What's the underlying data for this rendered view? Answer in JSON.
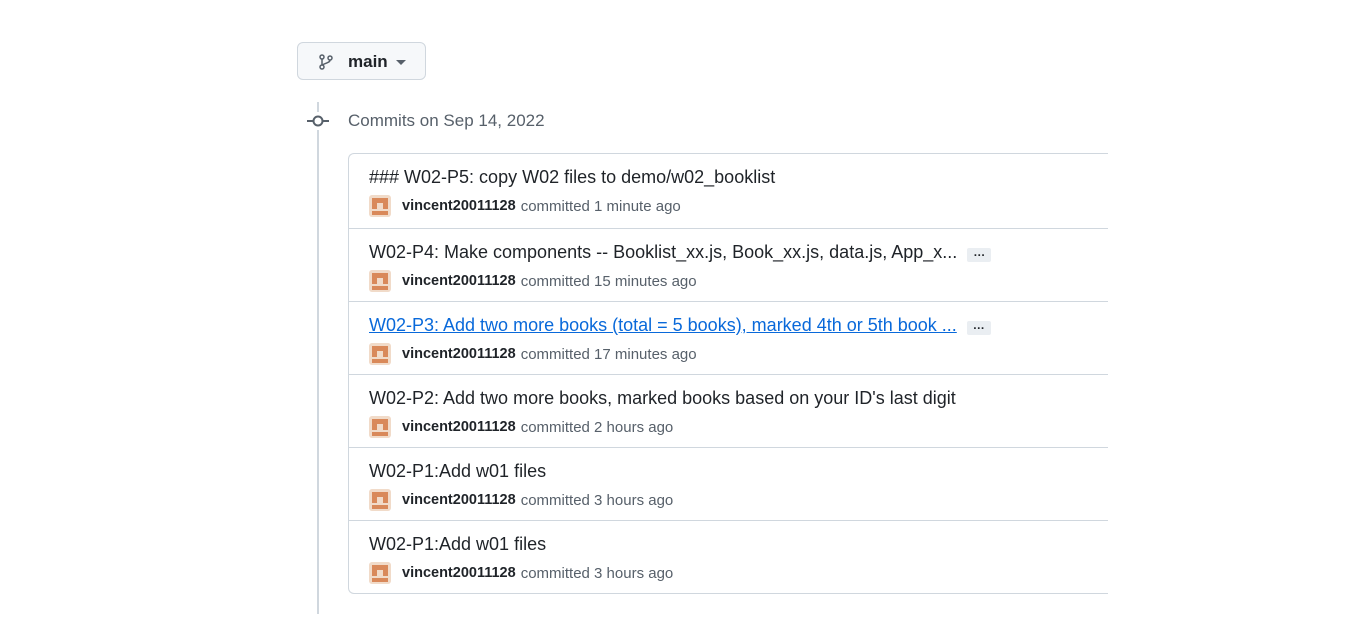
{
  "branch": {
    "icon": "git-branch-icon",
    "name": "main",
    "caret": "chevron-down-icon"
  },
  "timeline": {
    "icon": "git-commit-icon",
    "group_title": "Commits on Sep 14, 2022"
  },
  "commits": [
    {
      "title": "### W02-P5: copy W02 files to demo/w02_booklist",
      "author": "vincent20011128",
      "time_text": "committed 1 minute ago",
      "has_more": false,
      "is_link": false
    },
    {
      "title": "W02-P4: Make components -- Booklist_xx.js, Book_xx.js, data.js, App_x...",
      "author": "vincent20011128",
      "time_text": "committed 15 minutes ago",
      "has_more": true,
      "more_label": "…",
      "is_link": false
    },
    {
      "title": "W02-P3: Add two more books (total = 5 books), marked 4th or 5th book ...",
      "author": "vincent20011128",
      "time_text": "committed 17 minutes ago",
      "has_more": true,
      "more_label": "…",
      "is_link": true
    },
    {
      "title": "W02-P2: Add two more books, marked books based on your ID's last digit",
      "author": "vincent20011128",
      "time_text": "committed 2 hours ago",
      "has_more": false,
      "is_link": false
    },
    {
      "title": "W02-P1:Add w01 files",
      "author": "vincent20011128",
      "time_text": "committed 3 hours ago",
      "has_more": false,
      "is_link": false
    },
    {
      "title": "W02-P1:Add w01 files",
      "author": "vincent20011128",
      "time_text": "committed 3 hours ago",
      "has_more": false,
      "is_link": false
    }
  ],
  "colors": {
    "link": "#0969da",
    "muted": "#57606a",
    "border": "#d0d7de",
    "avatar": "#d9895a"
  }
}
